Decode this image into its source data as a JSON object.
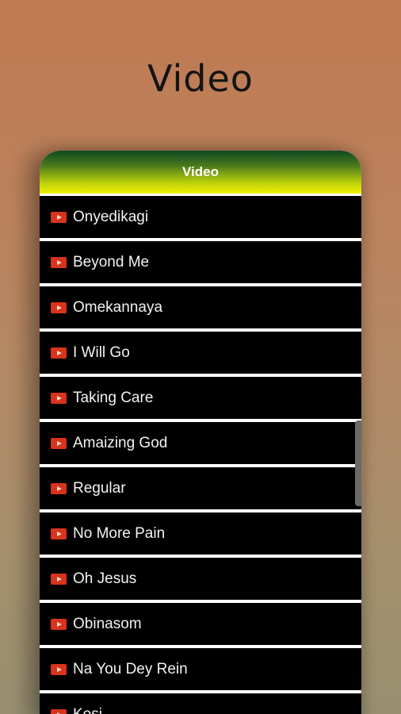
{
  "header": {
    "title": "Video"
  },
  "card": {
    "title": "Video"
  },
  "icons": {
    "row_icon": "youtube-play-icon",
    "row_icon_color": "#d8331c"
  },
  "colors": {
    "header_gradient_top": "#0f4a24",
    "header_gradient_bottom": "#f2f200",
    "row_background": "#000000",
    "row_text": "#f2f2f2"
  },
  "list": {
    "items": [
      {
        "label": "Onyedikagi"
      },
      {
        "label": "Beyond Me"
      },
      {
        "label": "Omekannaya"
      },
      {
        "label": "I Will Go"
      },
      {
        "label": "Taking Care"
      },
      {
        "label": "Amaizing God"
      },
      {
        "label": "Regular"
      },
      {
        "label": "No More Pain"
      },
      {
        "label": "Oh Jesus"
      },
      {
        "label": "Obinasom"
      },
      {
        "label": "Na You Dey Rein"
      },
      {
        "label": "Kosi"
      }
    ]
  }
}
